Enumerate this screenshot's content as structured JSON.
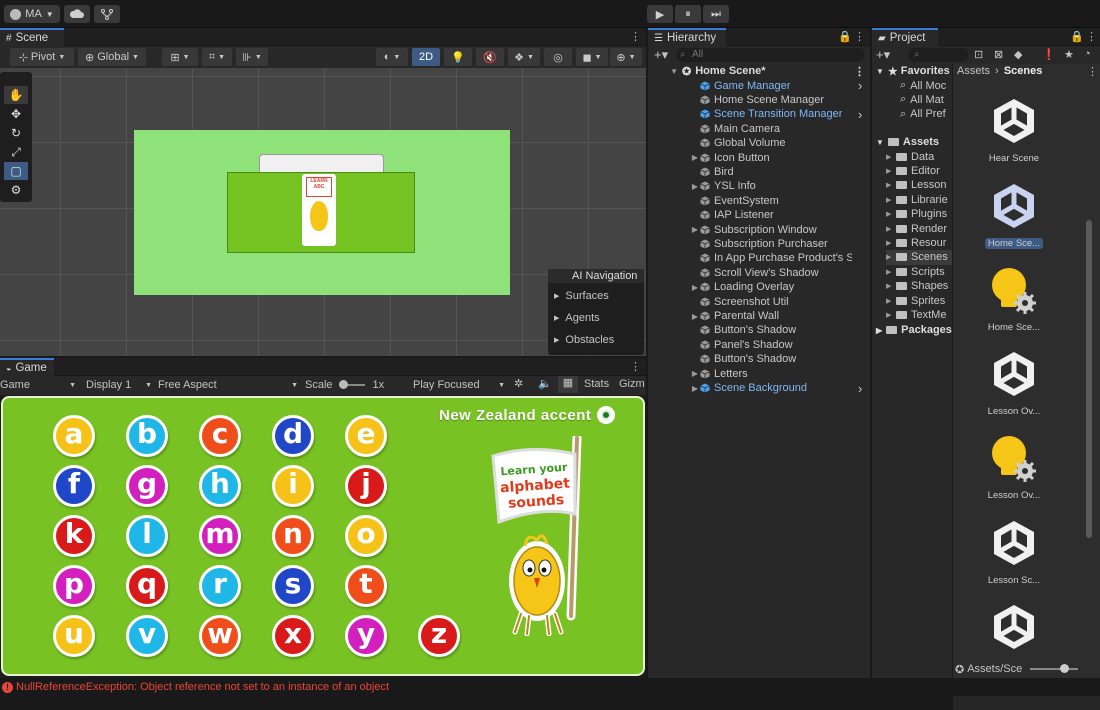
{
  "toolbar": {
    "account": "MA",
    "play": "▶",
    "pause": "⏸",
    "step": "⏭"
  },
  "scene": {
    "tab": "Scene",
    "pivot": "Pivot",
    "global": "Global",
    "mode_2d": "2D",
    "ai_nav": {
      "title": "AI Navigation",
      "items": [
        "Surfaces",
        "Agents",
        "Obstacles"
      ]
    }
  },
  "game": {
    "tab": "Game",
    "mode": "Game",
    "display": "Display 1",
    "aspect": "Free Aspect",
    "scale_label": "Scale",
    "scale_value": "1x",
    "play_focused": "Play Focused",
    "stats": "Stats",
    "gizmos": "Gizm",
    "accent_label": "New Zealand accent",
    "sign_text": [
      "Learn your",
      "alphabet",
      "sounds"
    ],
    "letters": [
      {
        "ch": "a",
        "color": "#f6c218"
      },
      {
        "ch": "b",
        "color": "#1fb6e8"
      },
      {
        "ch": "c",
        "color": "#ef4e1a"
      },
      {
        "ch": "d",
        "color": "#1f47c7"
      },
      {
        "ch": "e",
        "color": "#f6c218"
      },
      {
        "ch": "f",
        "color": "#1f47c7"
      },
      {
        "ch": "g",
        "color": "#d21fbd"
      },
      {
        "ch": "h",
        "color": "#1fb6e8"
      },
      {
        "ch": "i",
        "color": "#f6c218"
      },
      {
        "ch": "j",
        "color": "#d81a1a"
      },
      {
        "ch": "k",
        "color": "#d81a1a"
      },
      {
        "ch": "l",
        "color": "#1fb6e8"
      },
      {
        "ch": "m",
        "color": "#d21fbd"
      },
      {
        "ch": "n",
        "color": "#ef4e1a"
      },
      {
        "ch": "o",
        "color": "#f6c218"
      },
      {
        "ch": "p",
        "color": "#d21fbd"
      },
      {
        "ch": "q",
        "color": "#d81a1a"
      },
      {
        "ch": "r",
        "color": "#1fb6e8"
      },
      {
        "ch": "s",
        "color": "#1f47c7"
      },
      {
        "ch": "t",
        "color": "#ef4e1a"
      },
      {
        "ch": "u",
        "color": "#f6c218"
      },
      {
        "ch": "v",
        "color": "#1fb6e8"
      },
      {
        "ch": "w",
        "color": "#ef4e1a"
      },
      {
        "ch": "x",
        "color": "#d81a1a"
      },
      {
        "ch": "y",
        "color": "#d21fbd"
      },
      {
        "ch": "z",
        "color": "#d81a1a"
      }
    ]
  },
  "hierarchy": {
    "tab": "Hierarchy",
    "search_placeholder": "All",
    "scene_name": "Home Scene*",
    "items": [
      {
        "label": "Game Manager",
        "highlight": true,
        "fold": false,
        "arrow": true
      },
      {
        "label": "Home Scene Manager",
        "highlight": false,
        "fold": false,
        "arrow": false
      },
      {
        "label": "Scene Transition Manager",
        "highlight": true,
        "fold": false,
        "arrow": true
      },
      {
        "label": "Main Camera",
        "highlight": false,
        "fold": false,
        "arrow": false
      },
      {
        "label": "Global Volume",
        "highlight": false,
        "fold": false,
        "arrow": false
      },
      {
        "label": "Icon Button",
        "highlight": false,
        "fold": true,
        "arrow": false
      },
      {
        "label": "Bird",
        "highlight": false,
        "fold": false,
        "arrow": false
      },
      {
        "label": "YSL Info",
        "highlight": false,
        "fold": true,
        "arrow": false
      },
      {
        "label": "EventSystem",
        "highlight": false,
        "fold": false,
        "arrow": false
      },
      {
        "label": "IAP Listener",
        "highlight": false,
        "fold": false,
        "arrow": false
      },
      {
        "label": "Subscription Window",
        "highlight": false,
        "fold": true,
        "arrow": false
      },
      {
        "label": "Subscription Purchaser",
        "highlight": false,
        "fold": false,
        "arrow": false
      },
      {
        "label": "In App Purchase Product's Sh",
        "highlight": false,
        "fold": false,
        "arrow": false
      },
      {
        "label": "Scroll View's Shadow",
        "highlight": false,
        "fold": false,
        "arrow": false
      },
      {
        "label": "Loading Overlay",
        "highlight": false,
        "fold": true,
        "arrow": false
      },
      {
        "label": "Screenshot Util",
        "highlight": false,
        "fold": false,
        "arrow": false
      },
      {
        "label": "Parental Wall",
        "highlight": false,
        "fold": true,
        "arrow": false
      },
      {
        "label": "Button's Shadow",
        "highlight": false,
        "fold": false,
        "arrow": false
      },
      {
        "label": "Panel's Shadow",
        "highlight": false,
        "fold": false,
        "arrow": false
      },
      {
        "label": "Button's Shadow",
        "highlight": false,
        "fold": false,
        "arrow": false
      },
      {
        "label": "Letters",
        "highlight": false,
        "fold": true,
        "arrow": false
      },
      {
        "label": "Scene Background",
        "highlight": true,
        "fold": true,
        "arrow": true
      }
    ]
  },
  "project": {
    "tab": "Project",
    "favorites_label": "Favorites",
    "favorites": [
      "All Moc",
      "All Mat",
      "All Pref"
    ],
    "assets_label": "Assets",
    "folders": [
      "Data",
      "Editor",
      "Lesson",
      "Librarie",
      "Plugins",
      "Render",
      "Resour",
      "Scenes",
      "Scripts",
      "Shapes",
      "Sprites",
      "TextMe"
    ],
    "packages_label": "Packages",
    "breadcrumb_root": "Assets",
    "breadcrumb_current": "Scenes",
    "assets": [
      "Hear Scene",
      "Home Sce...",
      "Home Sce...",
      "Lesson Ov...",
      "Lesson Ov...",
      "Lesson Sc...",
      ""
    ],
    "footer_path": "Assets/Sce"
  },
  "console": {
    "message": "NullReferenceException: Object reference not set to an instance of an object"
  },
  "colors": {
    "game_bg": "#78c223",
    "accent_blue": "#3c7bd6",
    "error_red": "#e8463c",
    "highlight_text": "#7fb7f5"
  }
}
